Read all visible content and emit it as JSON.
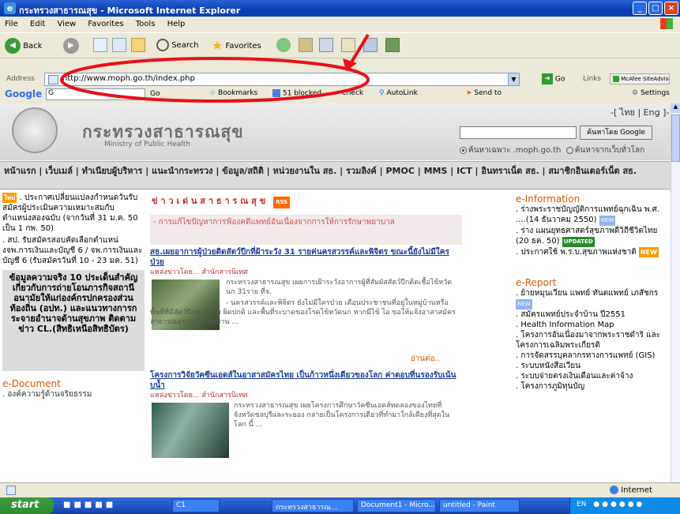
{
  "window": {
    "title": "กระทรวงสาธารณสุข - Microsoft Internet Explorer",
    "min_glyph": "_",
    "max_glyph": "□",
    "close_glyph": "×"
  },
  "menubar": [
    "File",
    "Edit",
    "View",
    "Favorites",
    "Tools",
    "Help"
  ],
  "toolbar": {
    "back_label": "Back",
    "search_label": "Search",
    "favorites_label": "Favorites"
  },
  "address": {
    "label": "Address",
    "url": "http://www.moph.go.th/index.php",
    "go_label": "Go",
    "links_label": "Links",
    "mcafee_label": "McAfee SiteAdvisor"
  },
  "googlebar": {
    "brand": "Google",
    "field_value": "G",
    "go_label": "Go",
    "bookmarks_label": "Bookmarks",
    "blocked_label": "51 blocked",
    "check_label": "Check",
    "autolink_label": "AutoLink",
    "sendto_label": "Send to",
    "settings_label": "Settings"
  },
  "page": {
    "lang_switch": "-[ ไทย | Eng ]-",
    "ministry_th": "กระทรวงสาธารณสุข",
    "ministry_en": "Ministry of Public Health",
    "search_button": "ค้นหาโดย Google",
    "search_opt_site": "ค้นหาเฉพาะ .moph.go.th",
    "search_opt_web": "ค้นหาจากเว็บทั่วโลก",
    "nav_line1": "หน้าแรก | เว็บเมล์ | ทำเนียบผู้บริหาร | แนะนำกระทรวง | ข้อมูล/สถิติ | หน่วยงานใน สธ. | รวมลิงค์ | PMOC | MMS | ICT | อินทราเน็ต สธ. | สมาชิกอินเตอร์เน็ต สธ.",
    "left": {
      "new_tag": "ใหม่",
      "item1": ". ประกาศเปลี่ยนแปลงกำหนดวันรับสมัครผู้ประเมินความเหมาะสมกับตำแหน่งสองฉบับ (จากวันที่ 31 ม.ค. 50 เป็น 1 กพ. 50)",
      "item2": ". สป. รับสมัครสอบคัดเลือกตำแหน่งจพ.การเงินและบัญชี 6 / จพ.การเงินและบัญชี 6 (รับสมัครวันที่ 10 - 23 มค. 51)",
      "highlight": "ข้อมูลความจริง 10 ประเด็นสำคัญ เกี่ยวกับการถ่ายโอนภารกิจสถานีอนามัยให้แก่องค์กรปกครองส่วนท้องถิ่น (อปท.) และแนวทางการกระจายอำนาจด้านสุขภาพ ติดตามข่าว CL.(สิทธิเหนือสิทธิบัตร)",
      "edoc_title": "e-Document",
      "edoc_item": ". องค์ความรู้ด้านจริยธรรม"
    },
    "middle": {
      "news_header": "ข่ า ว เ ด่ น ส า ธ า ร ณ สุ ข",
      "rss_label": "RSS",
      "pink_line": "- การแก้ไขปัญหาการฟ้องคดีแพทย์อันเนื่องจากการให้การรักษาพยาบาล",
      "headline1": "สธ.เผยอาการผู้ป่วยติดสัตว์ปีกที่ฝ้าระวัง 31 รายค่นครสวรรค์และพิจิตร ขณะนี้ยังไม่มีใครป่วย",
      "source1a": "แหล่งข่าวโดย...",
      "source1b": "สำนักสารนิเทศ",
      "body1a": "กระทรวงสาธารณสุข เผยการเฝ้าระวังอาการผู้ที่สัมผัสสัตว์ปีกติดเชื้อไข้หวัดนก 31ราย ที่จ.",
      "body1b": "- นครสวรรค์และพิจิตร ยังไม่มีใครป่วย เตือนประชาชนที่อยู่ในหมู่บ้านหรือพื้นที่ที่มีสัตว์ปีกป่วยตาย ผิดปกติ และพื้นที่ระบาดของโรคไข้หวัดนก หากมีไข้ ไอ ขอให้แจ้งอาสาสมัครสาธารณสุขประจำหมู่บ้าน ...",
      "more1": "อ่านต่อ..",
      "headline2": "โครงการวิจัยวัคซีนเอดส์ในอาสาสมัครไทย เป็นก้าวหนึ่งเดียวของโลก ค่าตอบที่นรองรับเน้นบน้ำ",
      "source2a": "แหล่งข่าวโดย...",
      "source2b": "สำนักสารนิเทศ",
      "body2": "กระทรวงสาธารณสุข เผยโครงการศึกษาวัคซีนเอดส์ทดลองของไทยที่จังหวัดชลบุรีและระยอง กลายเป็นโครงการเดียวที่ทำมาใกล้เคียงที่สุดในโลก นี้ ..."
    },
    "right": {
      "einfo_title": "e-Information",
      "einfo1": ". ร่างพระราชบัญญัติการแพทย์ฉุกเฉิน พ.ศ. ....(14 ธันวาคม 2550)",
      "einfo2": ". ร่าง แผนยุทธศาสตร์สุขภาพดีวิถีชีวิตไทย (20 ธค. 50)",
      "einfo3": ". ประกาศใช้ พ.ร.บ.สุขภาพแห่งชาติ",
      "updated": "UPDATED",
      "new_badge": "NEW",
      "ereport_title": "e-Report",
      "rep1": ". ย้ายหมุนเวียน แพทย์ ทันตแพทย์ เภสัชกร",
      "rep2": ". สมัครแพทย์ประจำบ้าน ปี2551",
      "rep3": ". Health Information Map",
      "rep4": ". โครงการอันเนื่องมาจากพระราชดำริ และโครงการเฉลิมพระเกียรติ",
      "rep5": ". การจัดสรรบุคลากรทางการแพทย์ (GIS)",
      "rep6": ". ระบบหนังสือเวียน",
      "rep7": ". ระบบจ่ายตรงเงินเดือนและค่าจ้าง",
      "rep8": ". โครงการภูมิทุนบัญ"
    }
  },
  "status": {
    "zone": "Internet"
  },
  "taskbar": {
    "start": "start",
    "tasks": [
      "C1",
      "กระทรวงสาธารณ...",
      "Document1 - Micro...",
      "untitled - Paint"
    ],
    "lang": "EN"
  },
  "colors": {
    "annotation_red": "#e8101a",
    "section_orange": "#e05a00",
    "link_blue": "#1f3d9a"
  }
}
